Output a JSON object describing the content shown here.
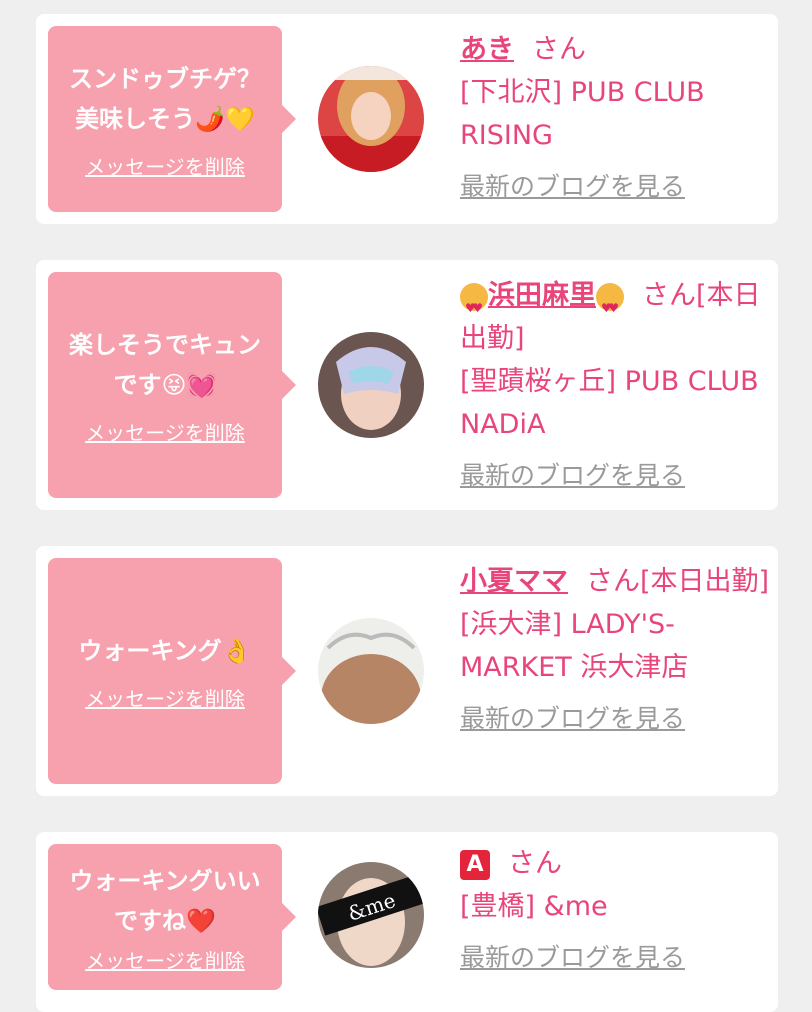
{
  "delete_label": "メッセージを削除",
  "blog_label": "最新のブログを見る",
  "colors": {
    "bubble": "#f7a0ae",
    "accent": "#e8457a",
    "link_gray": "#9a9a9a",
    "background": "#efefef"
  },
  "items": [
    {
      "message_line1": "スンドゥブチゲ？",
      "message_line2": "美味しそう🌶️💛",
      "name": "あき",
      "suffix": "さん",
      "shop": "[下北沢] PUB CLUB RISING"
    },
    {
      "message_line1": "楽しそうでキュン",
      "message_line2": "です😝💓",
      "name": "浜田麻里",
      "name_icon": "heart-eyes-cat-icon",
      "suffix": "さん[本日出勤]",
      "shop": "[聖蹟桜ヶ丘] PUB CLUB NADiA"
    },
    {
      "message_line1": "ウォーキング👌",
      "message_line2": "",
      "name": "小夏ママ",
      "suffix": "さん[本日出勤]",
      "shop": "[浜大津] LADY'S-MARKET 浜大津店"
    },
    {
      "message_line1": "ウォーキングいい",
      "message_line2": "ですね❤️",
      "name": "A",
      "name_icon": "letter-a-button-icon",
      "suffix": "さん",
      "shop": "[豊橋] &me",
      "avatar_text": "&me"
    }
  ]
}
